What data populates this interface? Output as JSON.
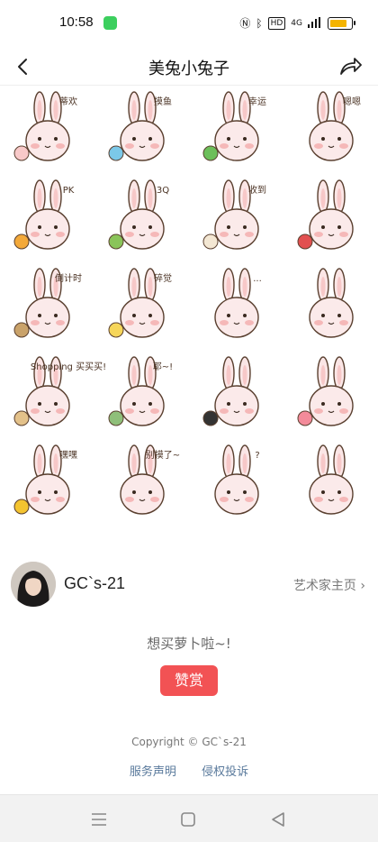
{
  "status": {
    "time": "10:58",
    "net": "4G"
  },
  "nav": {
    "title": "美兔小兔子"
  },
  "stickers": [
    {
      "label": "蒂欢"
    },
    {
      "label": "摸鱼"
    },
    {
      "label": "幸运"
    },
    {
      "label": "嗯嗯"
    },
    {
      "label": "PK"
    },
    {
      "label": "3Q"
    },
    {
      "label": "收到"
    },
    {
      "label": ""
    },
    {
      "label": "倒计时"
    },
    {
      "label": "碎觉"
    },
    {
      "label": "..."
    },
    {
      "label": ""
    },
    {
      "label": "Shopping 买买买!"
    },
    {
      "label": "耶~!"
    },
    {
      "label": ""
    },
    {
      "label": ""
    },
    {
      "label": "嘿嘿"
    },
    {
      "label": "别摸了~"
    },
    {
      "label": "?"
    },
    {
      "label": ""
    }
  ],
  "artist": {
    "name": "GC`s-21",
    "link": "艺术家主页"
  },
  "tip": {
    "text": "想买萝卜啦~!",
    "button": "赞赏"
  },
  "footer": {
    "copyright": "Copyright © GC`s-21",
    "link1": "服务声明",
    "link2": "侵权投诉"
  }
}
